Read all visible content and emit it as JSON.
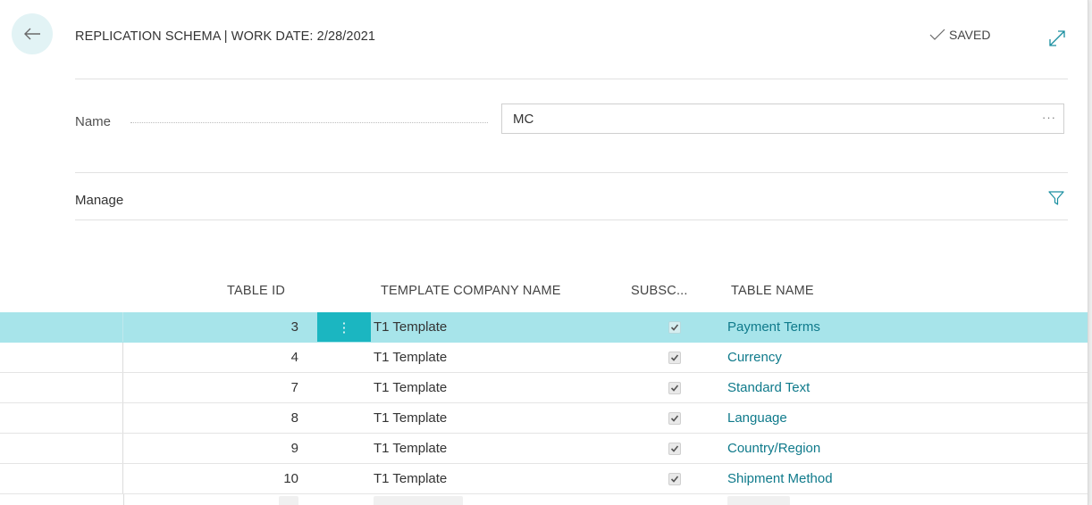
{
  "header": {
    "title": "REPLICATION SCHEMA | WORK DATE: 2/28/2021",
    "saved_label": "SAVED"
  },
  "fields": {
    "name_label": "Name",
    "name_value": "MC"
  },
  "actions": {
    "manage_label": "Manage"
  },
  "table": {
    "columns": {
      "table_id": "TABLE ID",
      "template_company_name": "TEMPLATE COMPANY NAME",
      "subscribed": "SUBSC...",
      "table_name": "TABLE NAME"
    },
    "selected_index": 0,
    "rows": [
      {
        "table_id": "3",
        "template": "T1 Template",
        "subscribed": true,
        "table_name": "Payment Terms"
      },
      {
        "table_id": "4",
        "template": "T1 Template",
        "subscribed": true,
        "table_name": "Currency"
      },
      {
        "table_id": "7",
        "template": "T1 Template",
        "subscribed": true,
        "table_name": "Standard Text"
      },
      {
        "table_id": "8",
        "template": "T1 Template",
        "subscribed": true,
        "table_name": "Language"
      },
      {
        "table_id": "9",
        "template": "T1 Template",
        "subscribed": true,
        "table_name": "Country/Region"
      },
      {
        "table_id": "10",
        "template": "T1 Template",
        "subscribed": true,
        "table_name": "Shipment Method"
      }
    ]
  },
  "colors": {
    "accent": "#1bb6c1",
    "selected_row": "#a7e4ea",
    "link": "#0f7a8b"
  },
  "icons": [
    "back-arrow-icon",
    "checkmark-icon",
    "expand-icon",
    "ellipsis-icon",
    "filter-icon",
    "row-menu-icon",
    "checkbox-checked-icon"
  ]
}
